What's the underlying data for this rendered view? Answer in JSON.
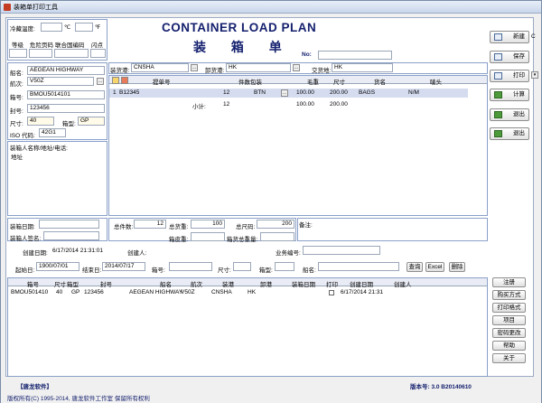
{
  "window": {
    "title": "装箱单打印工具"
  },
  "header": {
    "title_en": "CONTAINER LOAD PLAN",
    "title_cn": "装 箱 单",
    "no_label": "No:"
  },
  "reefer": {
    "temp_label": "冷藏温度:",
    "c_unit": "℃",
    "f_unit": "℉"
  },
  "danger": {
    "grade_label": "等级",
    "page_label": "危险页码",
    "un_label": "联合国编码",
    "flash_label": "闪点"
  },
  "left": {
    "ship_label": "船名:",
    "ship": "AEGEAN HIGHWAY",
    "voyage_label": "航次:",
    "voyage": "V50Z",
    "box_no_label": "箱号:",
    "box_no": "BMOU5014101",
    "seal_label": "封号:",
    "seal": "123456",
    "size_label": "尺寸:",
    "size": "40",
    "type_label": "箱型:",
    "type": "GP",
    "iso_label": "ISO 代码:",
    "iso": "42G1",
    "packer_label": "装箱人名称/地址/电话:",
    "address_label": "地址",
    "pack_date_label": "装箱日期:",
    "packer_sign_label": "装箱人签名:"
  },
  "ports": {
    "load_label": "装货港:",
    "load": "CNSHA",
    "discharge_label": "卸货港:",
    "discharge": "HK",
    "delivery_label": "交货地:",
    "delivery": "HK"
  },
  "cargo_table": {
    "headers": [
      "提单号",
      "件数包装",
      "毛重",
      "尺寸",
      "货名",
      "唛头"
    ],
    "row": {
      "idx": "1",
      "bl": "B12345",
      "qty": "12",
      "pkg": "BTN",
      "gross": "100.00",
      "measure": "200.00",
      "desc": "BAGS",
      "mark": "N/M"
    },
    "subtotal": {
      "label": "小计:",
      "qty": "12",
      "gross": "100.00",
      "measure": "200.00"
    }
  },
  "totals": {
    "total_qty_label": "总件数:",
    "total_qty": "12",
    "total_gross_label": "总货重:",
    "total_gross": "100",
    "total_measure_label": "总尺码:",
    "total_measure": "200",
    "tare_label": "箱皮重:",
    "gross_total_label": "箱货总重量:",
    "remark_label": "备注:"
  },
  "meta": {
    "created_label": "创建日期:",
    "created": "6/17/2014 21:31:01",
    "creator_label": "创建人:",
    "biz_no_label": "业务编号:"
  },
  "side_buttons": [
    "新建",
    "保存",
    "打印",
    "计算",
    "退出",
    "退出"
  ],
  "side_extra": "C",
  "filter": {
    "start_label": "起始日:",
    "start": "1900/07/01",
    "end_label": "结束日:",
    "end": "2014/07/17",
    "box_label": "箱号:",
    "size_label": "尺寸:",
    "type_label": "箱型:",
    "ship_label": "船名:",
    "query": "查询",
    "excel": "Excel",
    "delete": "删除"
  },
  "list": {
    "headers": [
      "箱号",
      "尺寸",
      "箱型",
      "封号",
      "船名",
      "航次",
      "装港",
      "卸港",
      "装箱日期",
      "打印",
      "创建日期",
      "创建人"
    ],
    "rows": [
      {
        "box": "BMOU501410",
        "size": "40",
        "type": "GP",
        "seal": "123456",
        "ship": "AEGEAN HIGHWAY",
        "voyage": "V50Z",
        "load": "CNSHA",
        "disch": "HK",
        "date": "",
        "created": "6/17/2014 21:31"
      }
    ]
  },
  "right_buttons": [
    "注册",
    "购买方式",
    "打印格式",
    "项目",
    "密码更改",
    "帮助",
    "关于"
  ],
  "footer": {
    "brand": "【唐龙软件】",
    "version": "版本号: 3.0 B20140610",
    "copyright": "版权所有(C) 1995-2014, 唐龙软件工作室 保留所有权利"
  },
  "colors": {
    "accent": "#14206e",
    "border": "#8aa0c8",
    "selected_row": "#d5dcf0"
  }
}
